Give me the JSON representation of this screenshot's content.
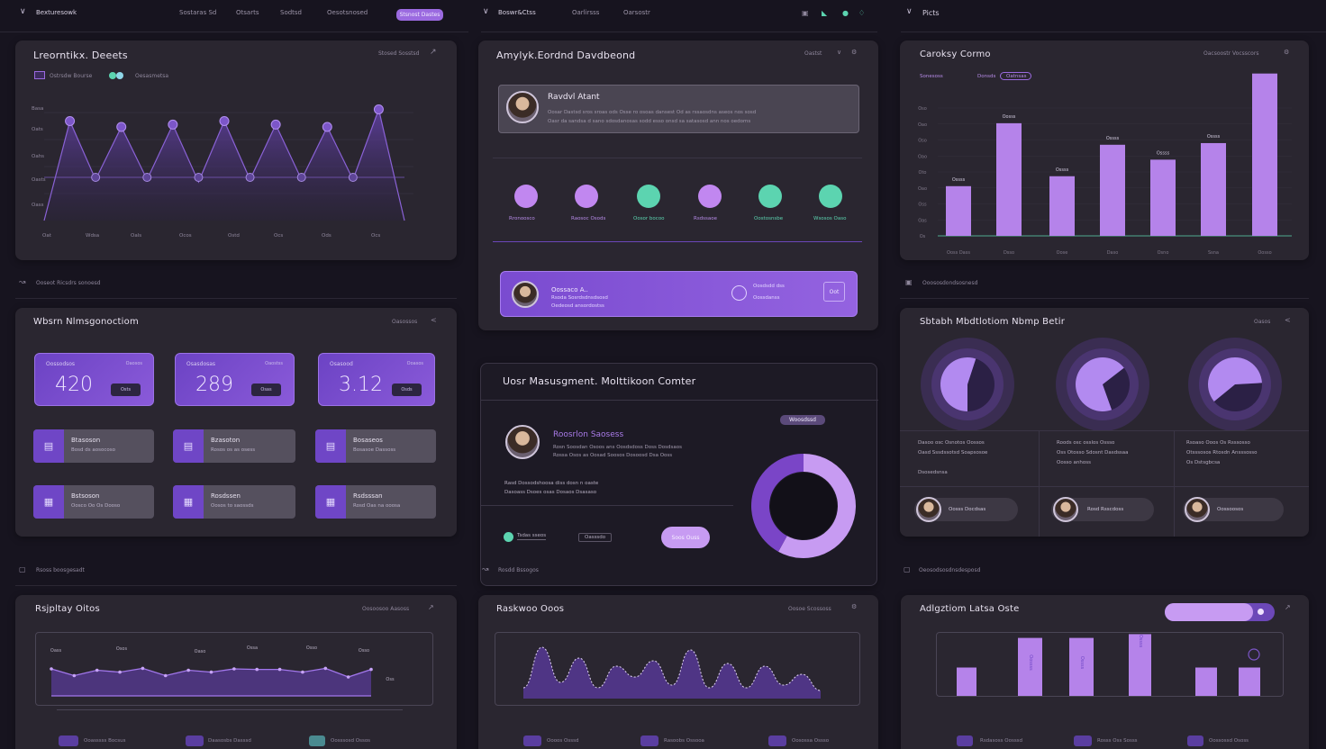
{
  "nav": {
    "col1": {
      "brand": "Bexturesowk",
      "items": [
        "Sostaras Sd",
        "Otsarts",
        "Sodtsd",
        "Oesotsnosed"
      ],
      "cta": "Stsnost Dastes"
    },
    "col2": {
      "brand": "Boswr&Ctss",
      "items": [
        "Oarlirsss",
        "Oarsostr"
      ]
    },
    "col3": {
      "brand": "Picts"
    }
  },
  "panels": {
    "line_top": {
      "title": "Lreorntikx. Deeets",
      "tools": "Stosed Sosstsd",
      "legend": "Ostrsdw Bourse",
      "legend2": "Oesasmetsa",
      "yticks": [
        "Basa",
        "Oats",
        "Oahs",
        "Oasts",
        "Oass"
      ],
      "xticks": [
        "Oat",
        "Wdsa",
        "Oals",
        "Ocos",
        "Ostd",
        "Ocs",
        "Ods",
        "Ocs"
      ],
      "footer": "Ooseot Ricsdrs sonoesd"
    },
    "profile": {
      "title": "Amylyk.Eordnd Davdbeond",
      "tools": "Oastst",
      "name": "Ravdvl Atant",
      "line1": "Oosar Dastsd sros sroas ods Osse ro osoas dansest Od as rssaosdns aseos nos sosd",
      "line2": "Oasr da sandsa d sano sdosdanosas sodd esso onsd sa satasosd ann nos oedoms",
      "steps": [
        "Rronoosco",
        "Raosoc Osods",
        "Oosor bocoo",
        "Rsdssaoe",
        "Oostosnsbe",
        "Wsosos Oaso"
      ],
      "banner_name": "Oossaco A..",
      "banner_l1": "Rsoda Sosrdsdnsdsosd",
      "banner_l2": "Oedeosd ansordostss",
      "banner_mid1": "Oosdsdd dss",
      "banner_mid2": "Oossdanss",
      "banner_btn": "Oot"
    },
    "bar_top": {
      "title": "Caroksy Cormo",
      "tools": "Oacsoostr Vocsscors",
      "legend": [
        "Sonesoss",
        "Donsds",
        "Oatnsas"
      ],
      "yticks": [
        "Oso",
        "Oao",
        "Oso",
        "Oao",
        "Oto",
        "Oao",
        "Oss",
        "Oas",
        "Os"
      ],
      "labels": [
        "Ossss",
        "Oosss",
        "Ossss",
        "Ossss",
        "Ossss",
        "Ossss",
        "Ossss"
      ],
      "xticks": [
        "Ooss Dass",
        "Dsso",
        "Oose",
        "Daso",
        "Osno",
        "Ssna",
        "Oosso"
      ],
      "footer": "Ooososdondsosnesd"
    },
    "stats": {
      "title": "Wbsrn Nlmsgonoctiom",
      "tools": "Oasossos",
      "cards": [
        {
          "label": "Oossodsos",
          "tag": "Oaosos",
          "value": "420",
          "btn": "Osts"
        },
        {
          "label": "Osasdosas",
          "tag": "Oaostss",
          "value": "289",
          "btn": "Osas"
        },
        {
          "label": "Osasood",
          "tag": "Ooasos",
          "value": "3.12",
          "btn": "Osds"
        }
      ],
      "tiles": [
        {
          "t1": "Btasoson",
          "t2": "Bosd ds aosocoso"
        },
        {
          "t1": "Bzasoton",
          "t2": "Rosos os as osess"
        },
        {
          "t1": "Bosaseos",
          "t2": "Bosasoe Dassoss"
        },
        {
          "t1": "Bstsoson",
          "t2": "Oosco Oo Os Dooso"
        },
        {
          "t1": "Rosdssen",
          "t2": "Oosos to saossds"
        },
        {
          "t1": "Rsdsssan",
          "t2": "Rosd Oas na ooosa"
        }
      ],
      "footer": "Rsoss boosgesadt"
    },
    "notif": {
      "title": "Uosr Masusgment. Molttikoon Comter",
      "badge": "Woosdssd",
      "name": "Roosrlon Saosess",
      "l1": "Rosn Soosdan Osoos ans Oosdsdoss Doss Dosdsaos",
      "l2": "Rossa Osos as Oosad  Soosos Dosoosd Dsa Ooss",
      "l3": "Rasd Dossodshoosa diss dosn n oaste",
      "l4": "Dasoass Dsoes osas Dosaos Dsasaso",
      "toggle1": "Tsdas sseos",
      "toggle2": "Oasssdo",
      "btn": "Soos Ouss",
      "footer": "Rosdd Bssogos"
    },
    "pies": {
      "title": "Sbtabh Mbdtlotiom Nbmp Betir",
      "tools": "Oasos",
      "texts": [
        [
          "Dasoo osc Osnotos Oossos",
          "Oasd Sssdssotsd Soapsosoe",
          "Dsosedsnsa"
        ],
        [
          "Roods osc osslos Ossso",
          "Oss Otosso Sdosnt Dasdssaa",
          "Oosso anhoss"
        ],
        [
          "Rsoaso Ooos Os Rsssosso",
          "Otsssosos Rtosdn Ansssosso",
          "Os Dstsgbcsa"
        ]
      ],
      "users": [
        "Oosss Docdsas",
        "Rosd Rsscdoss",
        "Oossoosos"
      ],
      "footer": "Oeosodsosdnsdesposd"
    },
    "line_bot": {
      "title": "Rsjpltay Oitos",
      "tools": "Oosoosoo Aasoss",
      "labels": [
        "Oass",
        "Osos",
        "Oaso",
        "Ossa",
        "Osso",
        "Osso",
        "Oss"
      ],
      "legend": [
        "Ooasssss Bocsus",
        "Daasosbs Dasssd",
        "Oosssosd Ossos"
      ]
    },
    "area_bot": {
      "title": "Raskwoo Ooos",
      "tools": "Oosoe Scossoss",
      "legend": [
        "Oooos Osssd",
        "Rasoobs Ossooa",
        "Oosossa Ossso"
      ]
    },
    "bar_bot": {
      "title": "Adlgztiom Latsa Oste",
      "labels": [
        "Oossss",
        "Ossss",
        "Ossss"
      ],
      "legend": [
        "Rsdasoss Oosssd",
        "Rosss Oss Sosss",
        "Oossossd Ososs"
      ]
    }
  },
  "chart_data": [
    {
      "type": "line",
      "title": "Lreorntikx. Deeets",
      "x": [
        1,
        2,
        3,
        4,
        5,
        6,
        7,
        8,
        9,
        10,
        11,
        12,
        13,
        14,
        15
      ],
      "values": [
        0,
        85,
        35,
        80,
        35,
        82,
        33,
        85,
        35,
        82,
        35,
        80,
        35,
        95,
        0
      ],
      "ylim": [
        0,
        100
      ]
    },
    {
      "type": "bar",
      "title": "Caroksy Cormo",
      "categories": [
        "1",
        "2",
        "3",
        "4",
        "5",
        "6",
        "7"
      ],
      "values": [
        30,
        68,
        36,
        55,
        46,
        56,
        98
      ],
      "ylim": [
        0,
        100
      ]
    },
    {
      "type": "pie",
      "values": [
        [
          45,
          55
        ],
        [
          30,
          70
        ],
        [
          40,
          60
        ]
      ]
    },
    {
      "type": "pie",
      "title": "Uosr Masusgment. Molttikoon Comter",
      "values": [
        58,
        42
      ],
      "colors": [
        "#c79bf2",
        "#7a45c7"
      ]
    },
    {
      "type": "line",
      "title": "Rsjpltay Oitos",
      "values": [
        60,
        35,
        55,
        48,
        62,
        35,
        55,
        48,
        60,
        58,
        58,
        48,
        62,
        30,
        58
      ],
      "ylim": [
        0,
        100
      ]
    },
    {
      "type": "area",
      "title": "Raskwoo Ooos",
      "values": [
        20,
        95,
        30,
        75,
        20,
        60,
        40,
        70,
        25,
        90,
        20,
        65,
        20,
        60,
        25,
        45,
        15
      ],
      "ylim": [
        0,
        100
      ]
    },
    {
      "type": "bar",
      "title": "Adlgztiom Latsa Oste",
      "values": [
        45,
        92,
        92,
        98,
        45,
        45
      ],
      "ylim": [
        0,
        100
      ]
    }
  ],
  "colors": {
    "accent": "#9b6ae0",
    "accent_light": "#c79bf2",
    "teal": "#5cd4b0",
    "bg": "#17141f",
    "panel": "#2a2630"
  }
}
